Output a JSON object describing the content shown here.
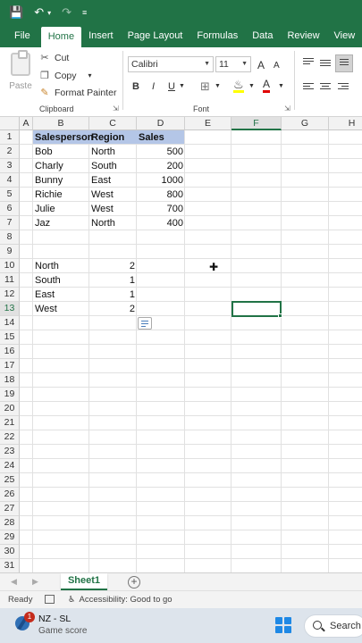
{
  "quick_access": {
    "save_icon": "save-icon",
    "undo_icon": "undo-icon",
    "redo_icon": "redo-icon",
    "customize_icon": "customize-icon"
  },
  "tabs": [
    "File",
    "Home",
    "Insert",
    "Page Layout",
    "Formulas",
    "Data",
    "Review",
    "View"
  ],
  "active_tab": "Home",
  "ribbon": {
    "clipboard": {
      "paste": "Paste",
      "cut": "Cut",
      "copy": "Copy",
      "format_painter": "Format Painter",
      "label": "Clipboard"
    },
    "font": {
      "name": "Calibri",
      "size": "11",
      "label": "Font",
      "bold": "B",
      "italic": "I",
      "underline": "U",
      "grow": "A",
      "shrink": "A",
      "font_color": "A"
    }
  },
  "columns": [
    "A",
    "B",
    "C",
    "D",
    "E",
    "F",
    "G",
    "H"
  ],
  "selected_column": "F",
  "selected_row": "13",
  "rows": [
    "1",
    "2",
    "3",
    "4",
    "5",
    "6",
    "7",
    "8",
    "9",
    "10",
    "11",
    "12",
    "13",
    "14",
    "15",
    "16",
    "17",
    "18",
    "19",
    "20",
    "21",
    "22",
    "23",
    "24",
    "25",
    "26",
    "27",
    "28",
    "29",
    "30",
    "31"
  ],
  "table": {
    "headers": [
      "Salesperson",
      "Region",
      "Sales"
    ],
    "rows": [
      [
        "Bob",
        "North",
        "500"
      ],
      [
        "Charly",
        "South",
        "200"
      ],
      [
        "Bunny",
        "East",
        "1000"
      ],
      [
        "Richie",
        "West",
        "800"
      ],
      [
        "Julie",
        "West",
        "700"
      ],
      [
        "Jaz",
        "North",
        "400"
      ]
    ]
  },
  "summary": [
    [
      "North",
      "2"
    ],
    [
      "South",
      "1"
    ],
    [
      "East",
      "1"
    ],
    [
      "West",
      "2"
    ]
  ],
  "sheet_tab": "Sheet1",
  "status": {
    "ready": "Ready",
    "accessibility": "Accessibility: Good to go"
  },
  "taskbar": {
    "badge": "1",
    "title": "NZ - SL",
    "subtitle": "Game score",
    "search": "Search"
  },
  "colors": {
    "accent": "#217346",
    "header_fill": "#b4c6e7"
  }
}
